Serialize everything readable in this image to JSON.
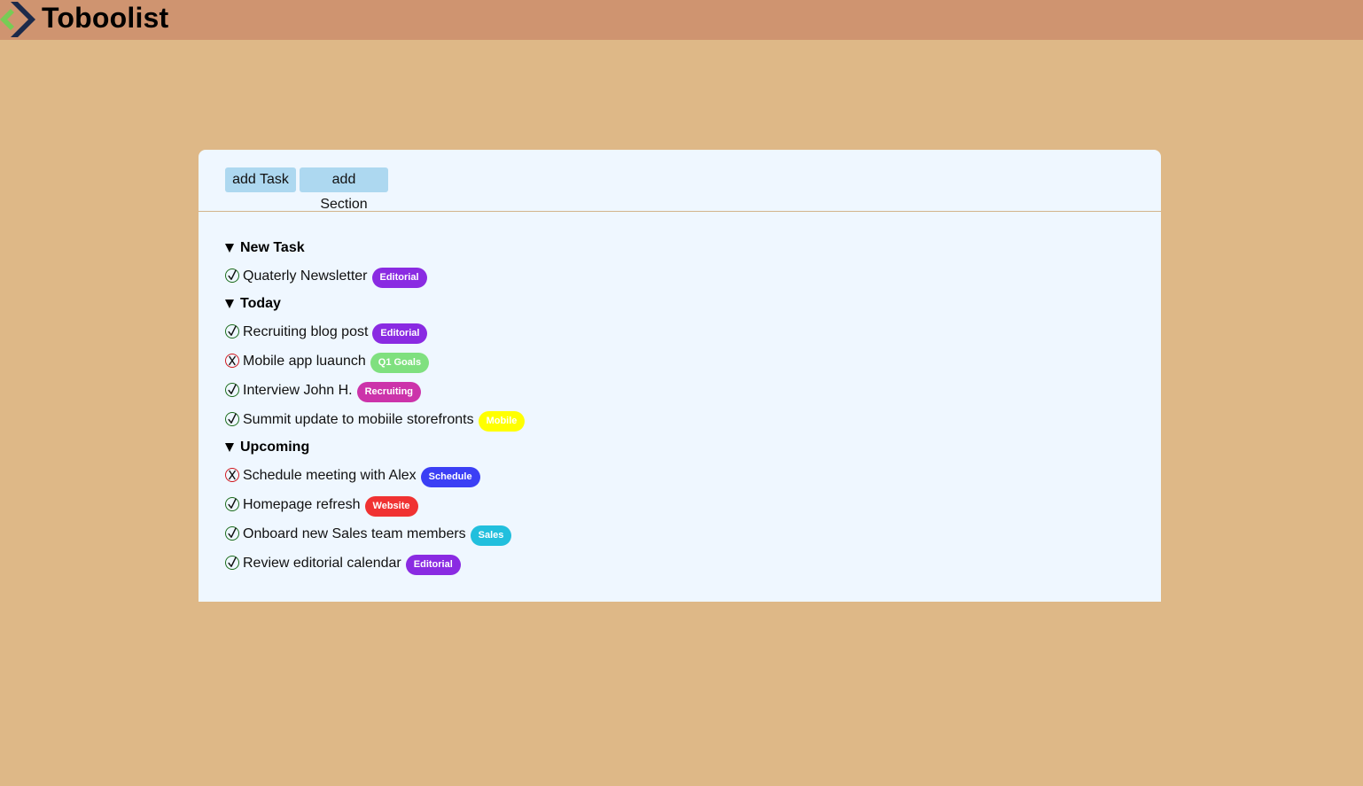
{
  "app": {
    "title": "Toboolist",
    "logo_icon": "diamond-chevron-logo-icon"
  },
  "toolbar": {
    "add_task_label": "add Task",
    "add_section_label": "add Section"
  },
  "colors": {
    "background": "#deb887",
    "topbar": "#cf9470",
    "panel": "#eff7ff",
    "button": "#add8f0",
    "done": "#1a6b1a",
    "not_done": "#d0181e"
  },
  "sections": [
    {
      "title": "New Task",
      "expanded_icon": "triangle-down-icon",
      "tasks": [
        {
          "label": "Quaterly Newsletter",
          "status": "done",
          "tag": "Editorial",
          "tag_color": "#8a2be2"
        }
      ]
    },
    {
      "title": "Today",
      "expanded_icon": "triangle-down-icon",
      "tasks": [
        {
          "label": "Recruiting blog post",
          "status": "done",
          "tag": "Editorial",
          "tag_color": "#8a2be2"
        },
        {
          "label": "Mobile app luaunch",
          "status": "not-done",
          "tag": "Q1 Goals",
          "tag_color": "#7fe07f"
        },
        {
          "label": "Interview John H.",
          "status": "done",
          "tag": "Recruiting",
          "tag_color": "#cc33aa"
        },
        {
          "label": "Summit update to mobiile storefronts",
          "status": "done",
          "tag": "Mobile",
          "tag_color": "#ffff00"
        }
      ]
    },
    {
      "title": "Upcoming",
      "expanded_icon": "triangle-down-icon",
      "tasks": [
        {
          "label": "Schedule meeting with Alex",
          "status": "not-done",
          "tag": "Schedule",
          "tag_color": "#3b3ff5"
        },
        {
          "label": "Homepage refresh",
          "status": "done",
          "tag": "Website",
          "tag_color": "#f03232"
        },
        {
          "label": "Onboard new Sales team members",
          "status": "done",
          "tag": "Sales",
          "tag_color": "#22bfdd"
        },
        {
          "label": "Review editorial calendar",
          "status": "done",
          "tag": "Editorial",
          "tag_color": "#8a2be2"
        }
      ]
    }
  ]
}
